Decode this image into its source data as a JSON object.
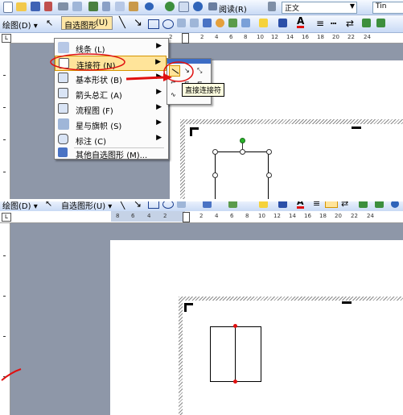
{
  "top": {
    "toolbar": {
      "read_label": "阅读",
      "read_key": "(R)",
      "style_value": "正文",
      "font_value": "Tin"
    },
    "drawbar": {
      "draw_label": "绘图",
      "draw_key": "(D)",
      "autoshapes_label": "自选图形",
      "autoshapes_key": "(U)"
    },
    "ruler": [
      "2",
      "2",
      "4",
      "6",
      "8",
      "10",
      "12",
      "14",
      "16",
      "18",
      "20",
      "22",
      "24"
    ],
    "menu": {
      "items": [
        {
          "label": "线条",
          "key": "(L)"
        },
        {
          "label": "连接符",
          "key": "(N)"
        },
        {
          "label": "基本形状",
          "key": "(B)"
        },
        {
          "label": "箭头总汇",
          "key": "(A)"
        },
        {
          "label": "流程图",
          "key": "(F)"
        },
        {
          "label": "星与旗帜",
          "key": "(S)"
        },
        {
          "label": "标注",
          "key": "(C)"
        },
        {
          "label": "其他自选图形",
          "key": "(M)..."
        }
      ]
    },
    "tooltip": "直接连接符"
  },
  "bottom": {
    "drawbar": {
      "draw_label": "绘图",
      "draw_key": "(D)",
      "autoshapes_label": "自选图形",
      "autoshapes_key": "(U)"
    },
    "ruler_left": [
      "8",
      "6",
      "4",
      "2"
    ],
    "ruler_right": [
      "2",
      "4",
      "6",
      "8",
      "10",
      "12",
      "14",
      "16",
      "18",
      "20",
      "22",
      "24"
    ]
  },
  "colors": {
    "toolbar": "#d6e3f7",
    "highlight": "#ffe49a",
    "annotation": "#e01010",
    "gray_canvas": "#8e97a8"
  }
}
